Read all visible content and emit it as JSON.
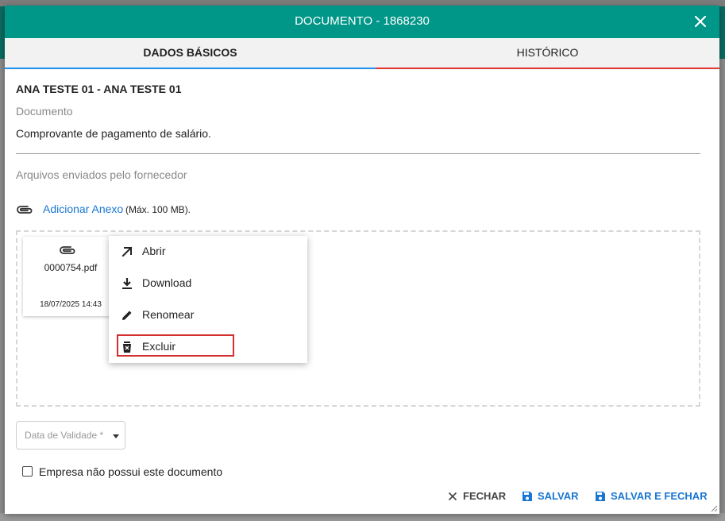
{
  "dialog": {
    "title": "DOCUMENTO - 1868230",
    "tabs": [
      {
        "label": "DADOS BÁSICOS",
        "active": true
      },
      {
        "label": "HISTÓRICO",
        "active": false
      }
    ]
  },
  "form": {
    "entity_name": "ANA TESTE 01 - ANA TESTE 01",
    "document_label": "Documento",
    "document_value": "Comprovante de pagamento de salário.",
    "files_label": "Arquivos enviados pelo fornecedor",
    "add_attachment_label": "Adicionar Anexo",
    "add_attachment_note": "(Máx. 100 MB).",
    "validity_placeholder": "Data de Validade *",
    "not_applicable_label": "Empresa não possui este documento",
    "not_applicable_checked": false
  },
  "attachment": {
    "icon": "paperclip-icon",
    "filename": "0000754.pdf",
    "date": "18/07/2025 14:43"
  },
  "context_menu": {
    "items": [
      {
        "label": "Abrir",
        "icon": "open-arrow-icon"
      },
      {
        "label": "Download",
        "icon": "download-icon"
      },
      {
        "label": "Renomear",
        "icon": "pencil-icon"
      },
      {
        "label": "Excluir",
        "icon": "trash-icon",
        "highlighted": true
      }
    ]
  },
  "footer": {
    "close_label": "FECHAR",
    "save_label": "SALVAR",
    "save_close_label": "SALVAR E FECHAR"
  },
  "colors": {
    "header": "#009688",
    "accent": "#1976d2",
    "active_tab_underline": "#2196f3",
    "inactive_tab_underline": "#e53935",
    "highlight_border": "#d32f2f"
  }
}
